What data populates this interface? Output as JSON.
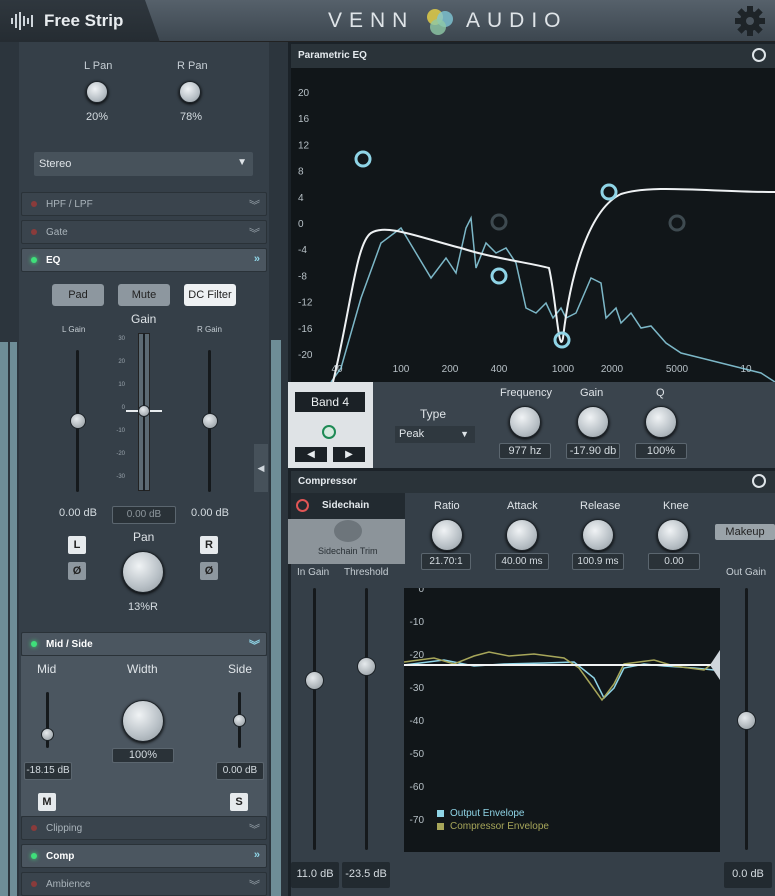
{
  "header": {
    "app_title": "Free Strip",
    "brand_left": "VENN",
    "brand_right": "AUDIO"
  },
  "pan": {
    "l_label": "L Pan",
    "l_value": "20%",
    "r_label": "R Pan",
    "r_value": "78%"
  },
  "mode_select": {
    "value": "Stereo"
  },
  "sections": {
    "hpf": "HPF / LPF",
    "gate": "Gate",
    "eq": "EQ",
    "midside": "Mid / Side",
    "clipping": "Clipping",
    "comp": "Comp",
    "ambience": "Ambience"
  },
  "eq_section": {
    "pad": "Pad",
    "mute": "Mute",
    "dc": "DC Filter",
    "l_gain_label": "L Gain",
    "gain_label": "Gain",
    "r_gain_label": "R Gain",
    "gain_scale": [
      "30",
      "20",
      "10",
      "0",
      "-10",
      "-20",
      "-30"
    ],
    "l_gain": "0.00 dB",
    "gain_box": "0.00 dB",
    "r_gain": "0.00 dB",
    "l_btn": "L",
    "r_btn": "R",
    "phase": "Ø",
    "pan_label": "Pan",
    "pan_value": "13%R"
  },
  "midside": {
    "mid_label": "Mid",
    "width_label": "Width",
    "side_label": "Side",
    "mid_value": "-18.15 dB",
    "width_value": "100%",
    "side_value": "0.00 dB",
    "m_btn": "M",
    "s_btn": "S"
  },
  "parametric_eq": {
    "title": "Parametric EQ",
    "y_ticks": [
      "20",
      "16",
      "12",
      "8",
      "4",
      "0",
      "-4",
      "-8",
      "-12",
      "-16",
      "-20"
    ],
    "x_ticks": [
      "40",
      "100",
      "200",
      "400",
      "1000",
      "2000",
      "5000",
      "10"
    ]
  },
  "band": {
    "name": "Band 4",
    "type_label": "Type",
    "type_value": "Peak",
    "freq_label": "Frequency",
    "freq_value": "977 hz",
    "gain_label": "Gain",
    "gain_value": "-17.90 db",
    "q_label": "Q",
    "q_value": "100%"
  },
  "compressor": {
    "title": "Compressor",
    "sidechain": "Sidechain",
    "sidechain_trim": "Sidechain Trim",
    "ratio_label": "Ratio",
    "ratio_value": "21.70:1",
    "attack_label": "Attack",
    "attack_value": "40.00 ms",
    "release_label": "Release",
    "release_value": "100.9 ms",
    "knee_label": "Knee",
    "knee_value": "0.00",
    "makeup": "Makeup",
    "in_gain_label": "In Gain",
    "in_gain_value": "11.0 dB",
    "threshold_label": "Threshold",
    "threshold_value": "-23.5 dB",
    "out_gain_label": "Out Gain",
    "out_gain_value": "0.0 dB",
    "meter_ticks": [
      "0",
      "-10",
      "-20",
      "-30",
      "-40",
      "-50",
      "-60",
      "-70"
    ],
    "legend_output": "Output Envelope",
    "legend_comp": "Compressor Envelope"
  },
  "colors": {
    "accent": "#8fd4e6",
    "output": "#8fd4e6",
    "compressor": "#a7a65a",
    "active_led": "#3fe07a"
  }
}
